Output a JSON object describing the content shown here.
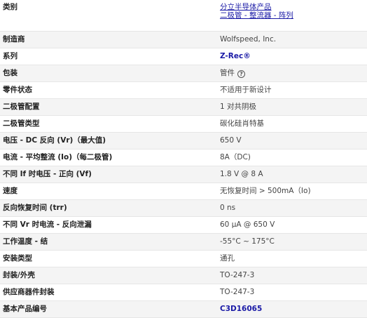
{
  "rows": [
    {
      "label": "类别",
      "value_line1": "分立半导体产品",
      "value_line2": "二极管 - 整流器 - 阵列"
    },
    {
      "label": "制造商",
      "value": "Wolfspeed, Inc."
    },
    {
      "label": "系列",
      "value": "Z-Rec®"
    },
    {
      "label": "包装",
      "value": "管件",
      "help_icon": "help-circle-icon"
    },
    {
      "label": "零件状态",
      "value": "不适用于新设计"
    },
    {
      "label": "二极管配置",
      "value": "1 对共阴极"
    },
    {
      "label": "二极管类型",
      "value": "碳化硅肖特基"
    },
    {
      "label": "电压 - DC 反向 (Vr)（最大值)",
      "value": "650 V"
    },
    {
      "label": "电流 - 平均整流 (Io)（每二极管)",
      "value": "8A（DC)"
    },
    {
      "label": "不同 If 时电压 - 正向 (Vf)",
      "value": "1.8 V @ 8 A"
    },
    {
      "label": "速度",
      "value": "无恢复时间 > 500mA（Io)"
    },
    {
      "label": "反向恢复时间 (trr)",
      "value": "0 ns"
    },
    {
      "label": "不同 Vr 时电流 - 反向泄漏",
      "value": "60 µA @ 650 V"
    },
    {
      "label": "工作温度 - 结",
      "value": "-55°C ~ 175°C"
    },
    {
      "label": "安装类型",
      "value": "通孔"
    },
    {
      "label": "封装/外壳",
      "value": "TO-247-3"
    },
    {
      "label": "供应商器件封装",
      "value": "TO-247-3"
    },
    {
      "label": "基本产品编号",
      "value": "C3D16065"
    }
  ],
  "help_icon_glyph": "?"
}
